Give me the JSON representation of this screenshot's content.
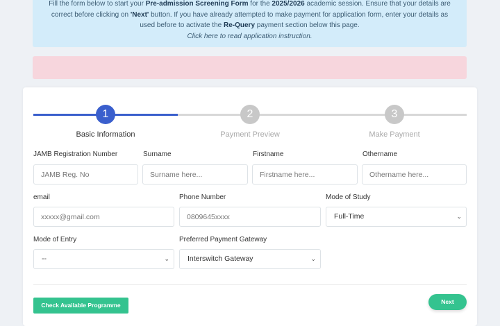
{
  "info": {
    "l1_a": "Fill the form below to start your ",
    "l1_b": "Pre-admission Screening Form",
    "l1_c": " for the ",
    "l1_d": "2025/2026",
    "l1_e": " academic session. Ensure that your details are",
    "l2_a": "correct before clicking on ",
    "l2_b": "'Next'",
    "l2_c": " button. If you have already attempted to make payment for application form, enter your details as",
    "l3_a": "used before to activate the ",
    "l3_b": "Re-Query",
    "l3_c": " payment section below this page.",
    "instruction_link": "Click here to read application instruction."
  },
  "steps": [
    {
      "number": "1",
      "label": "Basic Information"
    },
    {
      "number": "2",
      "label": "Payment Preview"
    },
    {
      "number": "3",
      "label": "Make Payment"
    }
  ],
  "fields": {
    "jamb": {
      "label": "JAMB Registration Number",
      "placeholder": "JAMB Reg. No"
    },
    "surname": {
      "label": "Surname",
      "placeholder": "Surname here..."
    },
    "firstname": {
      "label": "Firstname",
      "placeholder": "Firstname here..."
    },
    "othername": {
      "label": "Othername",
      "placeholder": "Othername here..."
    },
    "email": {
      "label": "email",
      "placeholder": "xxxxx@gmail.com"
    },
    "phone": {
      "label": "Phone Number",
      "placeholder": "0809645xxxx"
    },
    "mode_of_study": {
      "label": "Mode of Study",
      "selected": "Full-Time"
    },
    "mode_of_entry": {
      "label": "Mode of Entry",
      "selected": "--"
    },
    "gateway": {
      "label": "Preferred Payment Gateway",
      "selected": "Interswitch Gateway"
    }
  },
  "buttons": {
    "check": "Check Available Programme",
    "next": "Next"
  },
  "colors": {
    "accent": "#3a5fcd",
    "success": "#34c38f",
    "info_bg": "#d3ecfa",
    "alert_bg": "#f7d6dd"
  },
  "icons": {
    "select_chevron": "chevron-down-icon"
  }
}
